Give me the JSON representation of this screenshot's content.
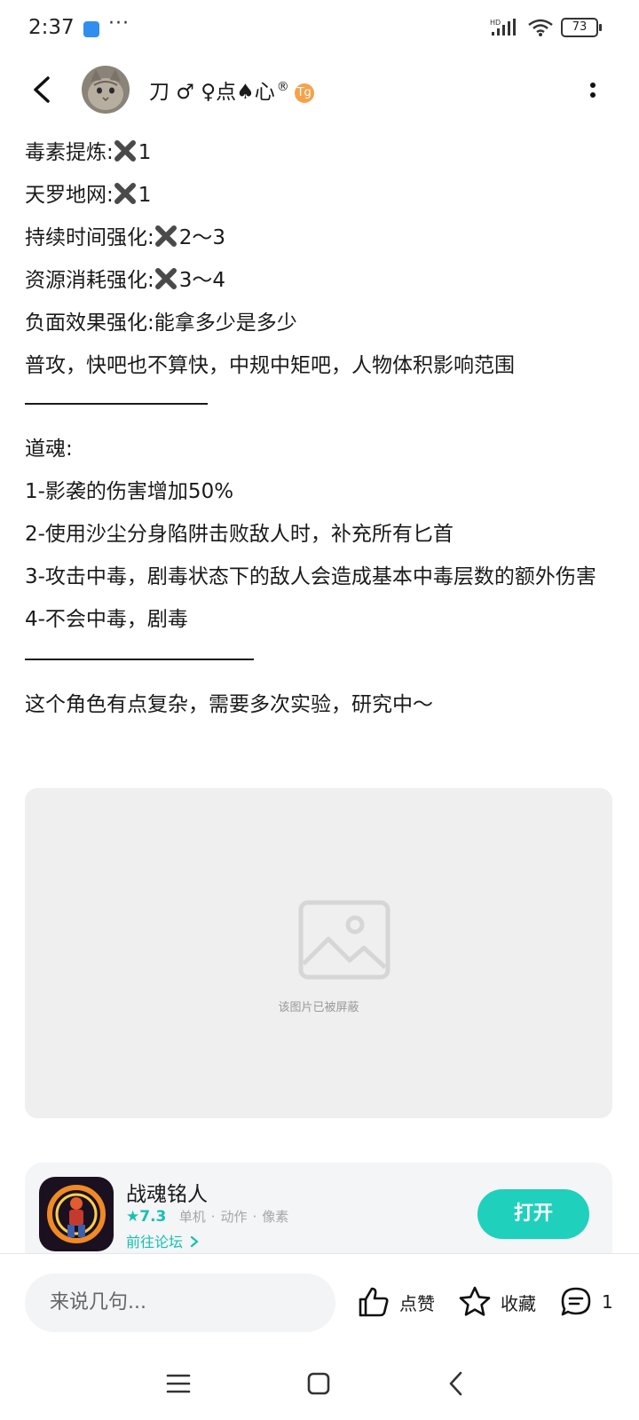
{
  "status_bar": {
    "time": "2:37",
    "more": "···",
    "network": "HD",
    "battery": "73"
  },
  "header": {
    "author_name": "刀 ♂ ♀点♠心",
    "registered_mark": "®",
    "badge": "Tg"
  },
  "post": {
    "lines": [
      {
        "label": "毒素提炼:",
        "value": "1"
      },
      {
        "label": "天罗地网:",
        "value": "1"
      },
      {
        "label": "持续时间强化:",
        "value": "2～3"
      },
      {
        "label": "资源消耗强化:",
        "value": "3～4"
      }
    ],
    "line_5": "负面效果强化:能拿多少是多少",
    "line_6": "普攻，快吧也不算快，中规中矩吧，人物体积影响范围",
    "soul_title": "道魂:",
    "soul_1": "1-影袭的伤害增加50%",
    "soul_2": "2-使用沙尘分身陷阱击败敌人时，补充所有匕首",
    "soul_3": "3-攻击中毒，剧毒状态下的敌人会造成基本中毒层数的额外伤害",
    "soul_4": "4-不会中毒，剧毒",
    "closing": "这个角色有点复杂，需要多次实验，研究中～",
    "image_blocked_text": "该图片已被屏蔽"
  },
  "game_card": {
    "title": "战魂铭人",
    "rating": "7.3",
    "tags": [
      "单机",
      "动作",
      "像素"
    ],
    "forum_link": "前往论坛",
    "open_label": "打开"
  },
  "bottom_bar": {
    "comment_placeholder": "来说几句...",
    "like_label": "点赞",
    "favorite_label": "收藏",
    "comment_count": "1"
  },
  "colors": {
    "accent": "#1fd0bd",
    "rating": "#19c0b0",
    "badge": "#f5a24b",
    "placeholder_bg": "#efefef"
  }
}
